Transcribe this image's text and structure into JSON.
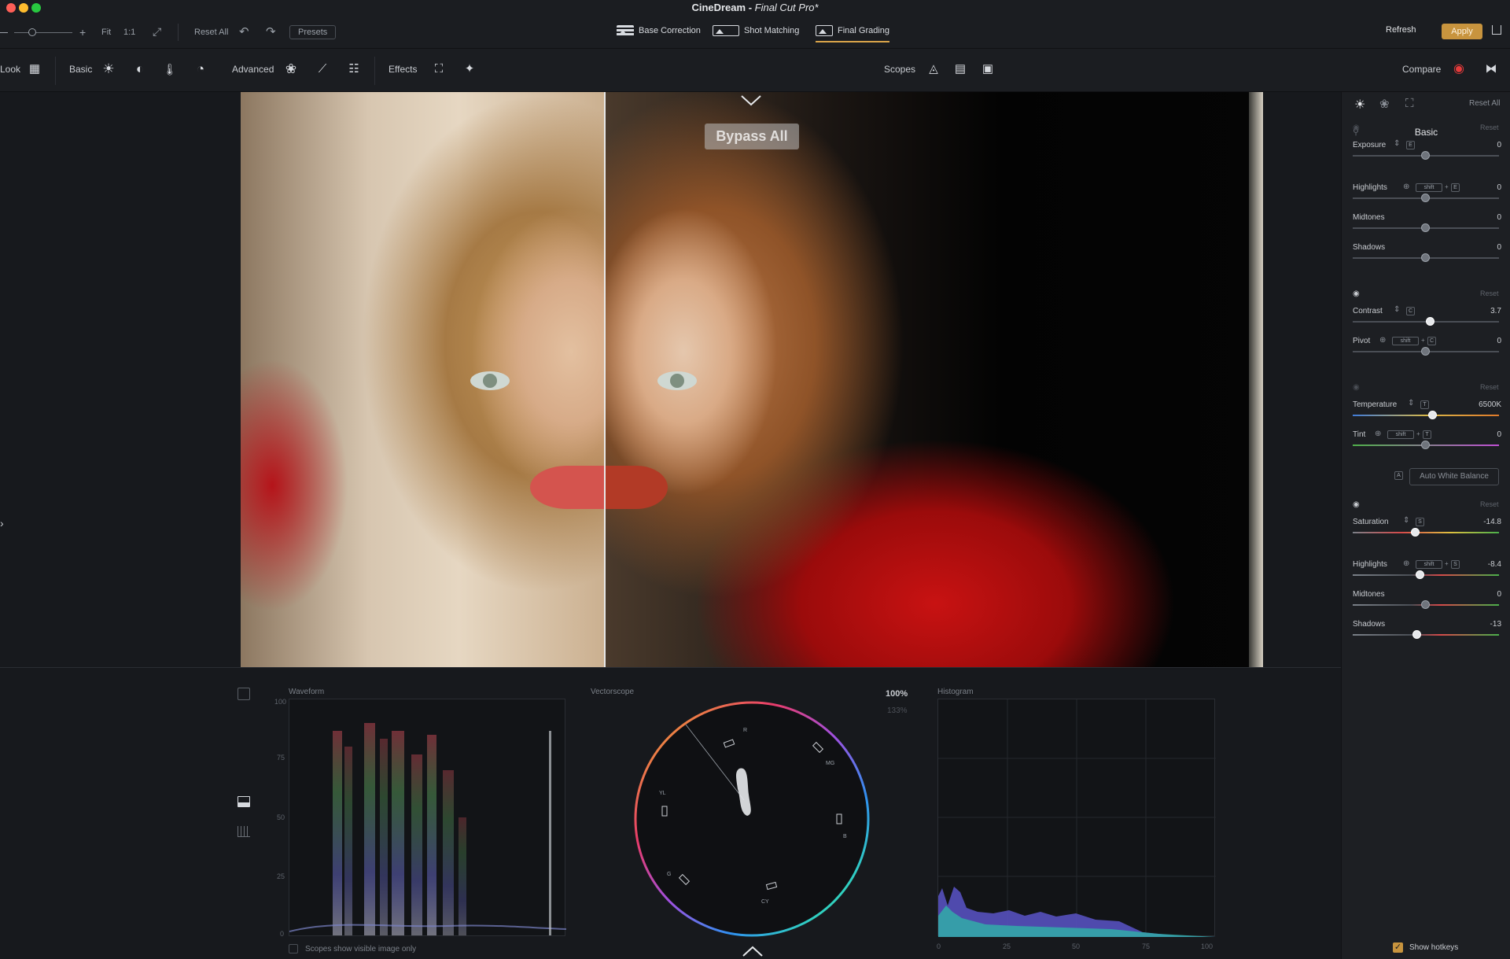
{
  "window": {
    "app_name": "CineDream",
    "separator": " - ",
    "document": "Final Cut Pro*"
  },
  "toolbar1": {
    "fit_label": "Fit",
    "one_to_one_label": "1:1",
    "reset_all_label": "Reset All",
    "presets_label": "Presets",
    "tabs": [
      {
        "label": "Base Correction"
      },
      {
        "label": "Shot Matching"
      },
      {
        "label": "Final Grading"
      }
    ],
    "refresh_label": "Refresh",
    "apply_label": "Apply"
  },
  "toolbar2": {
    "look_label": "Look",
    "basic_label": "Basic",
    "advanced_label": "Advanced",
    "effects_label": "Effects",
    "scopes_label": "Scopes",
    "compare_label": "Compare"
  },
  "preview": {
    "bypass_label": "Bypass All"
  },
  "scopes": {
    "waveform_title": "Waveform",
    "waveform_ticks": [
      "100",
      "75",
      "50",
      "25",
      "0"
    ],
    "vectorscope_title": "Vectorscope",
    "zoom_100": "100%",
    "zoom_133": "133%",
    "vector_labels": [
      "R",
      "MG",
      "B",
      "CY",
      "G",
      "YL"
    ],
    "histogram_title": "Histogram",
    "histogram_ticks": [
      "0",
      "25",
      "50",
      "75",
      "100"
    ],
    "visible_only_label": "Scopes show visible image only"
  },
  "panel": {
    "reset_all_label": "Reset All",
    "section_title": "Basic",
    "reset_label": "Reset",
    "shift_label": "shift",
    "plus": "+",
    "groups": [
      {
        "rows": [
          {
            "label": "Exposure",
            "value": "0",
            "hotkey": "E",
            "knob": 0.5
          },
          {
            "label": "Highlights",
            "value": "0",
            "hotkey": "E",
            "knob": 0.5
          },
          {
            "label": "Midtones",
            "value": "0",
            "knob": 0.5
          },
          {
            "label": "Shadows",
            "value": "0",
            "knob": 0.5
          }
        ]
      },
      {
        "rows": [
          {
            "label": "Contrast",
            "value": "3.7",
            "hotkey": "C",
            "knob": 0.53
          },
          {
            "label": "Pivot",
            "value": "0",
            "hotkey": "C",
            "knob": 0.5
          }
        ]
      },
      {
        "rows": [
          {
            "label": "Temperature",
            "value": "6500K",
            "hotkey": "T",
            "knob": 0.55
          },
          {
            "label": "Tint",
            "value": "0",
            "hotkey": "T",
            "knob": 0.5
          }
        ]
      },
      {
        "rows": [
          {
            "label": "Saturation",
            "value": "-14.8",
            "hotkey": "S",
            "knob": 0.43
          },
          {
            "label": "Highlights",
            "value": "-8.4",
            "hotkey": "S",
            "knob": 0.46
          },
          {
            "label": "Midtones",
            "value": "0",
            "knob": 0.5
          },
          {
            "label": "Shadows",
            "value": "-13",
            "knob": 0.44
          }
        ]
      }
    ],
    "awb_hotkey": "A",
    "awb_label": "Auto White Balance",
    "show_hotkeys_label": "Show hotkeys"
  },
  "colors": {
    "accent": "#c8943e",
    "background": "#17191d",
    "panel": "#1d1f23"
  }
}
